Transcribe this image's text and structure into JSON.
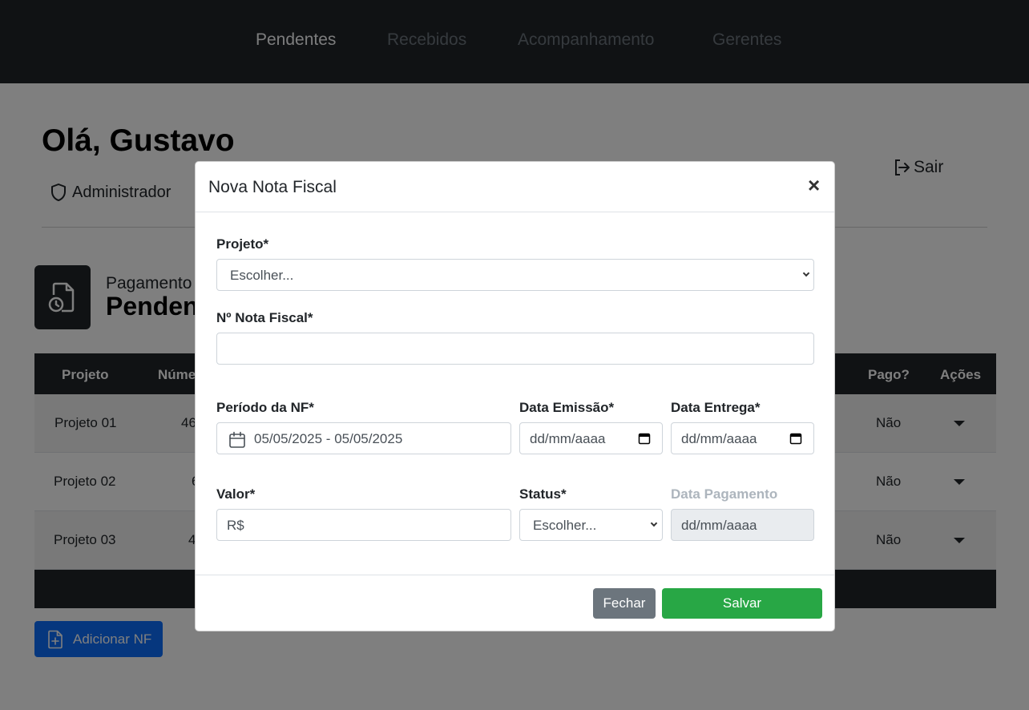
{
  "nav": {
    "items": [
      {
        "label": "Pendentes",
        "active": true
      },
      {
        "label": "Recebidos",
        "active": false
      },
      {
        "label": "Acompanhamento",
        "active": false
      },
      {
        "label": "Gerentes",
        "active": false
      }
    ]
  },
  "header": {
    "greeting": "Olá, Gustavo",
    "role": "Administrador",
    "logout_label": "Sair"
  },
  "section": {
    "subtitle": "Pagamento",
    "title": "Penden"
  },
  "table": {
    "columns": [
      "Projeto",
      "Núme",
      "Pago?",
      "Ações"
    ],
    "rows": [
      {
        "projeto": "Projeto 01",
        "numero": "46",
        "pago": "Não"
      },
      {
        "projeto": "Projeto 02",
        "numero": "6",
        "pago": "Não"
      },
      {
        "projeto": "Projeto 03",
        "numero": "4",
        "pago": "Não"
      }
    ]
  },
  "add_button_label": "Adicionar NF",
  "modal": {
    "title": "Nova Nota Fiscal",
    "close_symbol": "×",
    "projeto_label": "Projeto*",
    "projeto_value": "Escolher...",
    "nota_label": "Nº Nota Fiscal*",
    "nota_value": "",
    "periodo_label": "Período da NF*",
    "periodo_value": "05/05/2025 - 05/05/2025",
    "emissao_label": "Data Emissão*",
    "emissao_placeholder": "dd/mm/aaaa",
    "entrega_label": "Data Entrega*",
    "entrega_placeholder": "dd/mm/aaaa",
    "valor_label": "Valor*",
    "valor_placeholder": "R$",
    "status_label": "Status*",
    "status_value": "Escolher...",
    "pagamento_label": "Data Pagamento",
    "pagamento_placeholder": "dd/mm/aaaa",
    "fechar_label": "Fechar",
    "salvar_label": "Salvar"
  },
  "colors": {
    "navbar": "#212529",
    "primary": "#0d6efd",
    "success": "#28a745",
    "secondary": "#6c757d"
  }
}
